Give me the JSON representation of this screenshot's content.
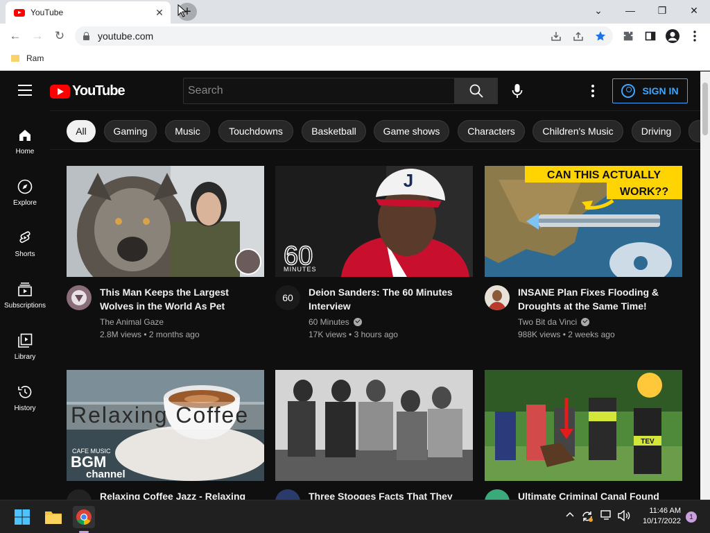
{
  "browser": {
    "tab_title": "YouTube",
    "url": "youtube.com",
    "bookmarks": [
      {
        "label": "Ram"
      }
    ]
  },
  "youtube": {
    "logo_text": "YouTube",
    "search_placeholder": "Search",
    "signin_label": "SIGN IN",
    "sidebar": [
      {
        "label": "Home",
        "icon": "home-icon"
      },
      {
        "label": "Explore",
        "icon": "compass-icon"
      },
      {
        "label": "Shorts",
        "icon": "shorts-icon"
      },
      {
        "label": "Subscriptions",
        "icon": "subscriptions-icon"
      },
      {
        "label": "Library",
        "icon": "library-icon"
      },
      {
        "label": "History",
        "icon": "history-icon"
      }
    ],
    "chips": [
      "All",
      "Gaming",
      "Music",
      "Touchdowns",
      "Basketball",
      "Game shows",
      "Characters",
      "Children's Music",
      "Driving"
    ],
    "videos": [
      {
        "title": "This Man Keeps the Largest Wolves in the World As Pet",
        "channel": "The Animal Gaze",
        "verified": false,
        "views": "2.8M views",
        "age": "2 months ago"
      },
      {
        "title": "Deion Sanders: The 60 Minutes Interview",
        "channel": "60 Minutes",
        "verified": true,
        "views": "17K views",
        "age": "3 hours ago",
        "thumb_text": "60",
        "thumb_sub": "MINUTES"
      },
      {
        "title": "INSANE Plan Fixes Flooding & Droughts at the Same Time!",
        "channel": "Two Bit da Vinci",
        "verified": true,
        "views": "988K views",
        "age": "2 weeks ago",
        "thumb_text_1": "CAN THIS ACTUALLY",
        "thumb_text_2": "WORK??"
      },
      {
        "title": "Relaxing Coffee Jazz - Relaxing",
        "thumb_text": "Relaxing Coffee",
        "thumb_sub_1": "CAFE MUSIC",
        "thumb_sub_2": "BGM",
        "thumb_sub_3": "channel"
      },
      {
        "title": "Three Stooges Facts That They"
      },
      {
        "title": "Ultimate Criminal Canal Found",
        "thumb_badge": "TEV"
      }
    ]
  },
  "taskbar": {
    "time": "11:46 AM",
    "date": "10/17/2022",
    "notifications": "1"
  },
  "colors": {
    "yt_red": "#ff0000",
    "accent_blue": "#3ea6ff",
    "background": "#0f0f0f"
  }
}
